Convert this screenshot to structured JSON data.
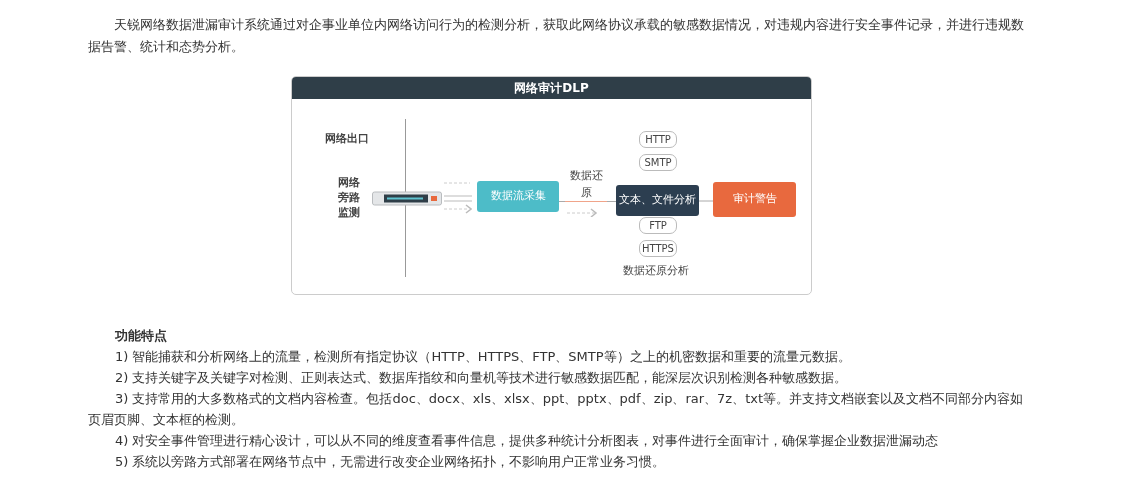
{
  "intro": "天锐网络数据泄漏审计系统通过对企事业单位内网络访问行为的检测分析，获取此网络协议承载的敏感数据情况，对违规内容进行安全事件记录，并进行违规数据告警、统计和态势分析。",
  "diagram": {
    "title": "网络审计DLP",
    "egress_label": "网络出口",
    "bypass_label": "网络旁路监测",
    "restore_label": "数据还原",
    "nodes": [
      {
        "kind": "collect",
        "label": "数据流采集"
      },
      {
        "kind": "analyze",
        "label": "文本、文件分析"
      },
      {
        "kind": "alert",
        "label": "审计警告"
      }
    ],
    "protocols_top": [
      "HTTP",
      "SMTP"
    ],
    "protocols_bottom": [
      "FTP",
      "HTTPS"
    ],
    "analysis_label": "数据还原分析"
  },
  "features": {
    "title": "功能特点",
    "items": [
      "1) 智能捕获和分析网络上的流量，检测所有指定协议（HTTP、HTTPS、FTP、SMTP等）之上的机密数据和重要的流量元数据。",
      "2) 支持关键字及关键字对检测、正则表达式、数据库指纹和向量机等技术进行敏感数据匹配，能深层次识别检测各种敏感数据。",
      "3) 支持常用的大多数格式的文档内容检查。包括doc、docx、xls、xlsx、ppt、pptx、pdf、zip、rar、7z、txt等。并支持文档嵌套以及文档不同部分内容如页眉页脚、文本框的检测。",
      "4) 对安全事件管理进行精心设计，可以从不同的维度查看事件信息，提供多种统计分析图表，对事件进行全面审计，确保掌握企业数据泄漏动态",
      "5) 系统以旁路方式部署在网络节点中，无需进行改变企业网络拓扑，不影响用户正常业务习惯。"
    ]
  }
}
